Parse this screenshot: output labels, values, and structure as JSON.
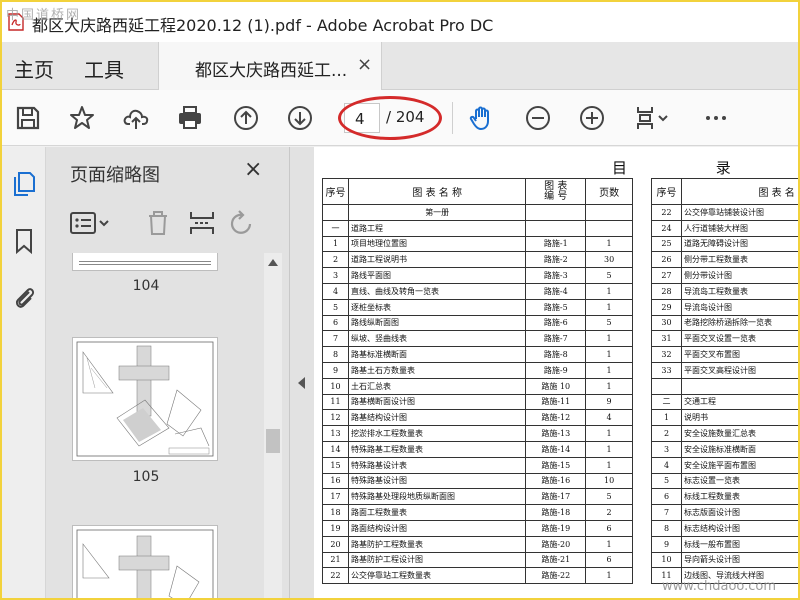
{
  "window": {
    "title": "都区大庆路西延工程2020.12 (1).pdf - Adobe Acrobat Pro DC",
    "watermark_top": "中国道桥网"
  },
  "tabs": {
    "home": "主页",
    "tools": "工具",
    "document": "都区大庆路西延工...",
    "close_glyph": "×"
  },
  "toolbar": {
    "current_page": "4",
    "total_pages": "/ 204",
    "icons": [
      "save-icon",
      "bookmark-star-icon",
      "cloud-upload-icon",
      "print-icon",
      "page-up-icon",
      "page-down-icon",
      "hand-tool-icon",
      "zoom-out-icon",
      "zoom-in-icon",
      "fit-page-icon",
      "more-icon"
    ],
    "accent_color": "#1a6fd1",
    "highlight_color": "#d42a2a"
  },
  "left_rail": {
    "icons": [
      "page-thumbnails-icon",
      "bookmarks-icon",
      "attachments-icon"
    ]
  },
  "thumbnail_panel": {
    "title": "页面缩略图",
    "close_glyph": "×",
    "tools": [
      "thumbnail-options-icon",
      "delete-page-icon",
      "insert-page-icon",
      "rotate-icon"
    ],
    "pages": [
      "104",
      "105"
    ]
  },
  "toc": {
    "title": "目 录",
    "headers": {
      "no": "序号",
      "name": "图 表 名 称",
      "code": "图 表\n编 号",
      "pages": "页数"
    },
    "section_volume": "第一册",
    "left_rows": [
      {
        "no": "一",
        "name": "道路工程",
        "code": "",
        "pages": ""
      },
      {
        "no": "1",
        "name": "项目地理位置图",
        "code": "路施-1",
        "pages": "1"
      },
      {
        "no": "2",
        "name": "道路工程说明书",
        "code": "路施-2",
        "pages": "30"
      },
      {
        "no": "3",
        "name": "路线平面图",
        "code": "路施-3",
        "pages": "5"
      },
      {
        "no": "4",
        "name": "直线、曲线及转角一览表",
        "code": "路施-4",
        "pages": "1"
      },
      {
        "no": "5",
        "name": "逐桩坐标表",
        "code": "路施-5",
        "pages": "1"
      },
      {
        "no": "6",
        "name": "路线纵断面图",
        "code": "路施-6",
        "pages": "5"
      },
      {
        "no": "7",
        "name": "纵坡、竖曲线表",
        "code": "路施-7",
        "pages": "1"
      },
      {
        "no": "8",
        "name": "路基标准横断面",
        "code": "路施-8",
        "pages": "1"
      },
      {
        "no": "9",
        "name": "路基土石方数量表",
        "code": "路施-9",
        "pages": "1"
      },
      {
        "no": "10",
        "name": "土石汇总表",
        "code": "路施 10",
        "pages": "1"
      },
      {
        "no": "11",
        "name": "路基横断面设计图",
        "code": "路施-11",
        "pages": "9"
      },
      {
        "no": "12",
        "name": "路基结构设计图",
        "code": "路施-12",
        "pages": "4"
      },
      {
        "no": "13",
        "name": "挖淤排水工程数量表",
        "code": "路施-13",
        "pages": "1"
      },
      {
        "no": "14",
        "name": "特殊路基工程数量表",
        "code": "路施-14",
        "pages": "1"
      },
      {
        "no": "15",
        "name": "特殊路基设计表",
        "code": "路施-15",
        "pages": "1"
      },
      {
        "no": "16",
        "name": "特殊路基设计图",
        "code": "路施-16",
        "pages": "10"
      },
      {
        "no": "17",
        "name": "特殊路基处理段地质纵断面图",
        "code": "路施-17",
        "pages": "5"
      },
      {
        "no": "18",
        "name": "路面工程数量表",
        "code": "路施-18",
        "pages": "2"
      },
      {
        "no": "19",
        "name": "路面结构设计图",
        "code": "路施-19",
        "pages": "6"
      },
      {
        "no": "20",
        "name": "路基防护工程数量表",
        "code": "路施-20",
        "pages": "1"
      },
      {
        "no": "21",
        "name": "路基防护工程设计图",
        "code": "路施-21",
        "pages": "6"
      },
      {
        "no": "22",
        "name": "公交停靠站工程数量表",
        "code": "路施-22",
        "pages": "1"
      }
    ],
    "right_rows": [
      {
        "no": "22",
        "name": "公交停靠站铺装设计图"
      },
      {
        "no": "24",
        "name": "人行道铺装大样图"
      },
      {
        "no": "25",
        "name": "道路无障碍设计图"
      },
      {
        "no": "26",
        "name": "侧分带工程数量表"
      },
      {
        "no": "27",
        "name": "侧分带设计图"
      },
      {
        "no": "28",
        "name": "导流岛工程数量表"
      },
      {
        "no": "29",
        "name": "导流岛设计图"
      },
      {
        "no": "30",
        "name": "老路挖除桥涵拆除一览表"
      },
      {
        "no": "31",
        "name": "平面交叉设置一览表"
      },
      {
        "no": "32",
        "name": "平面交叉布置图"
      },
      {
        "no": "33",
        "name": "平面交叉高程设计图"
      },
      {
        "no": "",
        "name": ""
      },
      {
        "no": "二",
        "name": "交通工程"
      },
      {
        "no": "1",
        "name": "说明书"
      },
      {
        "no": "2",
        "name": "安全设施数量汇总表"
      },
      {
        "no": "3",
        "name": "安全设施标准横断面"
      },
      {
        "no": "4",
        "name": "安全设施平面布置图"
      },
      {
        "no": "5",
        "name": "标志设置一览表"
      },
      {
        "no": "6",
        "name": "标线工程数量表"
      },
      {
        "no": "7",
        "name": "标志版面设计图"
      },
      {
        "no": "8",
        "name": "标志结构设计图"
      },
      {
        "no": "9",
        "name": "标线一般布置图"
      },
      {
        "no": "10",
        "name": "导向箭头设计图"
      },
      {
        "no": "11",
        "name": "边线图、导流线大样图"
      }
    ]
  },
  "watermark_bottom": "www.chdaoo.com"
}
